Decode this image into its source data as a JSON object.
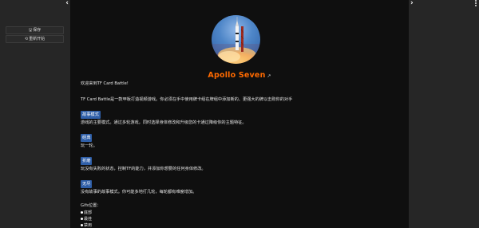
{
  "left_sidebar": {
    "collapse_icon": "chevron-left-icon",
    "save_label": "保存",
    "restart_label": "重新开始"
  },
  "right_sidebar": {
    "expand_icon": "chevron-right-icon"
  },
  "story": {
    "title": "Apollo Seven",
    "title_color": "#ff6a00",
    "welcome": "欢迎来到TF Card Battle!",
    "description": "TF Card Battle是一款甲板打造视频游戏。你必须在手中使用牌卡组在牌组中添加新的、更强大的牌以击败你的对手",
    "modes": [
      {
        "label": "故事模式",
        "desc": "游戏的主要模式。通过多轮游戏，同时选择身体修改和升级您的卡通过降级你的主题特征。"
      },
      {
        "label": "经典",
        "desc": "玩一轮。"
      },
      {
        "label": "折磨",
        "desc": "玩没有失败的状态，控制TF的能力，并添加你想要的任何身体修改。"
      },
      {
        "label": "无尽",
        "desc": "没有故事的故事模式。你可能多地打几轮，每轮都有难度增加。"
      }
    ],
    "gifs_label": "Gifs位置：",
    "gif_options": [
      "底部",
      "最佳",
      "禁用"
    ]
  }
}
